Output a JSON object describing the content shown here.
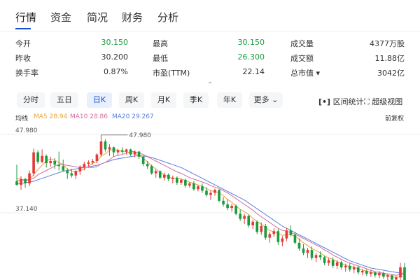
{
  "tabs": [
    {
      "label": "行情"
    },
    {
      "label": "资金"
    },
    {
      "label": "简况"
    },
    {
      "label": "财务"
    },
    {
      "label": "分析"
    }
  ],
  "stats": [
    [
      {
        "label": "今开",
        "value": "30.150",
        "color": "#1a9b3c"
      },
      {
        "label": "最高",
        "value": "30.150",
        "color": "#1a9b3c"
      },
      {
        "label": "成交量",
        "value": "4377万股",
        "color": "#333333"
      }
    ],
    [
      {
        "label": "昨收",
        "value": "30.200",
        "color": "#333333"
      },
      {
        "label": "最低",
        "value": "26.300",
        "color": "#1a9b3c"
      },
      {
        "label": "成交额",
        "value": "11.88亿",
        "color": "#333333"
      }
    ],
    [
      {
        "label": "换手率",
        "value": "0.87%",
        "color": "#333333"
      },
      {
        "label": "市盈(TTM)",
        "value": "22.14",
        "color": "#333333"
      },
      {
        "label": "总市值 ▾",
        "value": "3042亿",
        "color": "#333333"
      }
    ]
  ],
  "periods": [
    "分时",
    "五日",
    "日K",
    "周K",
    "月K",
    "季K",
    "年K",
    "更多"
  ],
  "active_period": "日K",
  "tools": {
    "range_stats": "区间统计",
    "super_view": "超级视图"
  },
  "chevron": "⌃",
  "ma": {
    "label": "均线",
    "ma5": "MA5 28.94",
    "ma10": "MA10 28.86",
    "ma20": "MA20 29.267",
    "adjust": "前复权",
    "colors": {
      "ma5": "#e8a33c",
      "ma10": "#d46b9a",
      "ma20": "#5b7ee0"
    }
  },
  "chart_data": {
    "type": "candlestick",
    "y_axis_labels": [
      "47.980",
      "37.140"
    ],
    "high_annotation": "47.980",
    "up_color": "#e53935",
    "down_color": "#1a9b3c",
    "candles": [
      [
        41.5,
        43.8,
        40.9,
        41.0
      ],
      [
        41.0,
        42.2,
        40.3,
        41.8
      ],
      [
        41.8,
        42.0,
        40.6,
        41.2
      ],
      [
        41.2,
        43.0,
        40.8,
        42.6
      ],
      [
        42.6,
        46.0,
        42.2,
        45.5
      ],
      [
        45.5,
        45.8,
        43.9,
        44.2
      ],
      [
        44.2,
        45.9,
        44.0,
        45.0
      ],
      [
        45.0,
        45.2,
        43.4,
        44.0
      ],
      [
        44.0,
        44.9,
        43.5,
        44.3
      ],
      [
        44.3,
        44.7,
        43.2,
        43.8
      ],
      [
        43.8,
        45.6,
        43.0,
        43.6
      ],
      [
        43.6,
        44.5,
        42.8,
        43.0
      ],
      [
        43.0,
        43.3,
        41.8,
        42.6
      ],
      [
        42.6,
        43.2,
        42.0,
        42.3
      ],
      [
        42.3,
        43.0,
        41.8,
        42.9
      ],
      [
        42.9,
        43.7,
        42.4,
        43.5
      ],
      [
        43.5,
        44.2,
        43.0,
        43.9
      ],
      [
        43.9,
        44.4,
        43.5,
        44.1
      ],
      [
        44.1,
        44.6,
        43.8,
        44.3
      ],
      [
        44.3,
        45.4,
        44.0,
        45.2
      ],
      [
        45.2,
        47.9,
        44.9,
        47.0
      ],
      [
        47.0,
        47.3,
        45.6,
        45.9
      ],
      [
        45.9,
        46.6,
        45.0,
        46.2
      ],
      [
        46.2,
        46.3,
        44.9,
        45.5
      ],
      [
        45.5,
        46.0,
        45.0,
        45.8
      ],
      [
        45.8,
        46.2,
        45.3,
        45.6
      ],
      [
        45.6,
        46.0,
        45.2,
        45.9
      ],
      [
        45.9,
        46.0,
        45.0,
        45.2
      ],
      [
        45.2,
        45.8,
        44.8,
        45.6
      ],
      [
        45.6,
        45.7,
        44.6,
        44.9
      ],
      [
        44.9,
        45.0,
        43.6,
        43.9
      ],
      [
        43.9,
        44.3,
        43.2,
        43.6
      ],
      [
        43.6,
        43.8,
        42.4,
        42.6
      ],
      [
        42.6,
        43.1,
        42.0,
        42.9
      ],
      [
        42.9,
        43.0,
        41.8,
        42.0
      ],
      [
        42.0,
        42.7,
        41.6,
        42.4
      ],
      [
        42.4,
        42.6,
        41.5,
        41.8
      ],
      [
        41.8,
        42.3,
        41.2,
        42.0
      ],
      [
        42.0,
        42.2,
        41.0,
        41.3
      ],
      [
        41.3,
        41.9,
        41.0,
        41.7
      ],
      [
        41.7,
        41.9,
        40.6,
        40.9
      ],
      [
        40.9,
        41.4,
        40.6,
        41.2
      ],
      [
        41.2,
        41.5,
        40.2,
        40.4
      ],
      [
        40.4,
        41.0,
        40.1,
        40.8
      ],
      [
        40.8,
        41.2,
        39.9,
        40.2
      ],
      [
        40.2,
        40.7,
        39.4,
        39.6
      ],
      [
        39.6,
        40.2,
        38.9,
        39.9
      ],
      [
        39.9,
        40.5,
        39.5,
        40.3
      ],
      [
        40.3,
        40.4,
        38.6,
        38.8
      ],
      [
        38.8,
        39.3,
        38.0,
        38.3
      ],
      [
        38.3,
        39.0,
        37.5,
        37.8
      ],
      [
        37.8,
        38.4,
        37.3,
        38.1
      ],
      [
        38.1,
        38.3,
        36.8,
        37.0
      ],
      [
        37.0,
        37.6,
        36.0,
        36.3
      ],
      [
        36.3,
        37.0,
        35.6,
        36.7
      ],
      [
        36.7,
        36.9,
        35.1,
        35.4
      ],
      [
        35.4,
        36.2,
        34.9,
        35.9
      ],
      [
        35.9,
        36.1,
        34.2,
        34.5
      ],
      [
        34.5,
        35.8,
        34.1,
        35.3
      ],
      [
        35.3,
        35.6,
        33.4,
        33.7
      ],
      [
        33.7,
        34.5,
        33.0,
        34.2
      ],
      [
        34.2,
        35.0,
        33.8,
        34.6
      ],
      [
        34.6,
        34.9,
        32.7,
        33.1
      ],
      [
        33.1,
        33.9,
        32.5,
        33.6
      ],
      [
        33.6,
        35.0,
        33.2,
        34.7
      ],
      [
        34.7,
        35.4,
        33.9,
        34.1
      ],
      [
        34.1,
        34.5,
        32.8,
        33.0
      ],
      [
        33.0,
        33.6,
        31.9,
        32.2
      ],
      [
        32.2,
        32.8,
        31.3,
        31.6
      ],
      [
        31.6,
        32.3,
        30.9,
        32.0
      ],
      [
        32.0,
        32.5,
        30.6,
        30.9
      ],
      [
        30.9,
        31.6,
        30.3,
        31.3
      ],
      [
        31.3,
        31.8,
        30.6,
        31.0
      ],
      [
        31.0,
        31.2,
        29.9,
        30.2
      ],
      [
        30.2,
        30.9,
        29.8,
        30.6
      ],
      [
        30.6,
        31.0,
        29.5,
        29.8
      ],
      [
        29.8,
        30.6,
        29.4,
        30.3
      ],
      [
        30.3,
        30.5,
        29.3,
        29.6
      ],
      [
        29.6,
        30.1,
        29.0,
        29.8
      ],
      [
        29.8,
        30.2,
        29.0,
        29.3
      ],
      [
        29.3,
        29.9,
        28.8,
        29.6
      ],
      [
        29.6,
        29.8,
        28.6,
        28.9
      ],
      [
        28.9,
        29.4,
        28.5,
        29.1
      ],
      [
        29.1,
        29.3,
        28.4,
        28.7
      ],
      [
        28.7,
        29.2,
        28.3,
        28.9
      ],
      [
        28.9,
        29.0,
        28.2,
        28.5
      ],
      [
        28.5,
        29.1,
        28.1,
        28.8
      ],
      [
        28.8,
        29.0,
        28.0,
        28.3
      ],
      [
        28.3,
        28.7,
        27.8,
        28.5
      ],
      [
        28.5,
        28.6,
        27.6,
        27.9
      ],
      [
        27.9,
        28.4,
        27.5,
        28.2
      ],
      [
        28.2,
        30.2,
        27.8,
        29.6
      ],
      [
        29.6,
        30.2,
        26.3,
        27.0
      ]
    ],
    "ma5": [
      41.9,
      41.8,
      41.7,
      41.8,
      42.4,
      43.1,
      43.7,
      44.3,
      44.6,
      44.4,
      44.1,
      43.8,
      43.2,
      42.9,
      42.9,
      42.9,
      43.2,
      43.6,
      44.0,
      44.2,
      45.0,
      45.3,
      45.8,
      45.9,
      45.8,
      45.6,
      45.6,
      45.4,
      45.4,
      45.1,
      44.7,
      44.2,
      43.6,
      43.2,
      42.7,
      42.4,
      42.1,
      41.9,
      41.9,
      41.8,
      41.6,
      41.4,
      41.2,
      41.0,
      40.8,
      40.5,
      40.2,
      40.1,
      39.9,
      39.5,
      39.0,
      38.6,
      38.1,
      37.6,
      37.3,
      36.9,
      36.4,
      35.9,
      35.6,
      35.1,
      34.7,
      34.5,
      34.3,
      34.0,
      34.1,
      34.1,
      33.9,
      33.5,
      33.0,
      32.6,
      32.2,
      31.9,
      31.6,
      31.2,
      30.9,
      30.7,
      30.4,
      30.1,
      29.9,
      29.7,
      29.6,
      29.4,
      29.2,
      29.1,
      28.9,
      28.8,
      28.7,
      28.6,
      28.5,
      28.3,
      28.2,
      28.3,
      28.4
    ],
    "ma10": [
      41.6,
      41.6,
      41.6,
      41.7,
      41.9,
      42.4,
      42.7,
      43.0,
      43.3,
      43.6,
      43.8,
      43.8,
      43.7,
      43.6,
      43.5,
      43.4,
      43.5,
      43.4,
      43.4,
      43.5,
      43.9,
      44.1,
      44.5,
      44.9,
      45.1,
      45.2,
      45.4,
      45.6,
      45.6,
      45.4,
      45.2,
      44.9,
      44.6,
      44.3,
      44.0,
      43.7,
      43.4,
      43.1,
      42.8,
      42.6,
      42.3,
      42.0,
      41.8,
      41.6,
      41.4,
      41.2,
      40.9,
      40.7,
      40.5,
      40.2,
      39.9,
      39.5,
      39.1,
      38.7,
      38.3,
      37.9,
      37.5,
      37.0,
      36.6,
      36.2,
      35.8,
      35.4,
      35.0,
      34.7,
      34.6,
      34.4,
      34.2,
      33.9,
      33.6,
      33.3,
      33.0,
      32.7,
      32.4,
      32.0,
      31.7,
      31.3,
      31.0,
      30.7,
      30.4,
      30.2,
      30.0,
      29.8,
      29.6,
      29.4,
      29.2,
      29.0,
      28.9,
      28.8,
      28.7,
      28.6,
      28.5,
      28.6,
      28.6
    ],
    "ma20": [
      41.2,
      41.2,
      41.3,
      41.4,
      41.5,
      41.7,
      41.9,
      42.1,
      42.3,
      42.5,
      42.7,
      42.9,
      43.0,
      43.1,
      43.2,
      43.3,
      43.4,
      43.5,
      43.6,
      43.7,
      43.9,
      44.1,
      44.3,
      44.5,
      44.6,
      44.7,
      44.8,
      44.9,
      45.0,
      45.0,
      45.0,
      44.9,
      44.8,
      44.6,
      44.4,
      44.2,
      44.0,
      43.8,
      43.6,
      43.4,
      43.1,
      42.8,
      42.5,
      42.2,
      41.9,
      41.6,
      41.3,
      41.0,
      40.7,
      40.4,
      40.1,
      39.8,
      39.5,
      39.2,
      38.9,
      38.5,
      38.1,
      37.7,
      37.3,
      36.9,
      36.5,
      36.1,
      35.7,
      35.3,
      35.0,
      34.7,
      34.4,
      34.1,
      33.8,
      33.5,
      33.2,
      32.9,
      32.6,
      32.3,
      32.0,
      31.7,
      31.4,
      31.1,
      30.8,
      30.5,
      30.3,
      30.1,
      29.9,
      29.7,
      29.5,
      29.4,
      29.3,
      29.2,
      29.1,
      29.0,
      28.9,
      28.8,
      28.8
    ]
  }
}
